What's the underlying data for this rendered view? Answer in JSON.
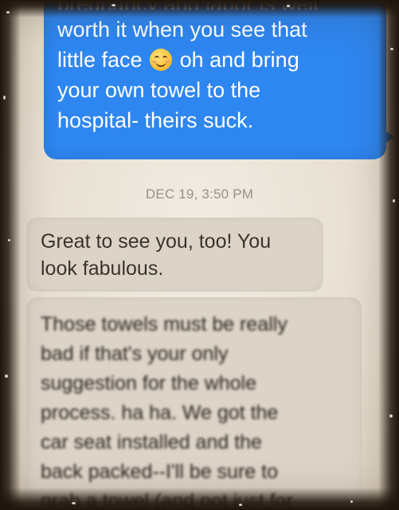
{
  "outgoing_message": {
    "cut_line": "pregnancy and labor is well",
    "lines": [
      {
        "text": "worth it when you see that"
      },
      {
        "before_emoji": "little face",
        "emoji": "smiling-face-icon",
        "after_emoji": "oh and bring"
      },
      {
        "text": "your own towel to the"
      },
      {
        "text": "hospital- theirs suck."
      }
    ],
    "bubble_color": "#2e86f0"
  },
  "timestamp": "DEC 19, 3:50 PM",
  "incoming_messages": [
    {
      "lines": [
        "Great to see you, too! You",
        "look fabulous."
      ]
    },
    {
      "lines": [
        "Those towels must be really",
        "bad if that's your only",
        "suggestion for the whole",
        "process. ha ha. We got the",
        "car seat installed and the",
        "back packed--I'll be sure to",
        "grab a towel (and not just for"
      ]
    }
  ],
  "colors": {
    "incoming_bubble": "#ddd4c8",
    "frame": "#1f150c"
  }
}
